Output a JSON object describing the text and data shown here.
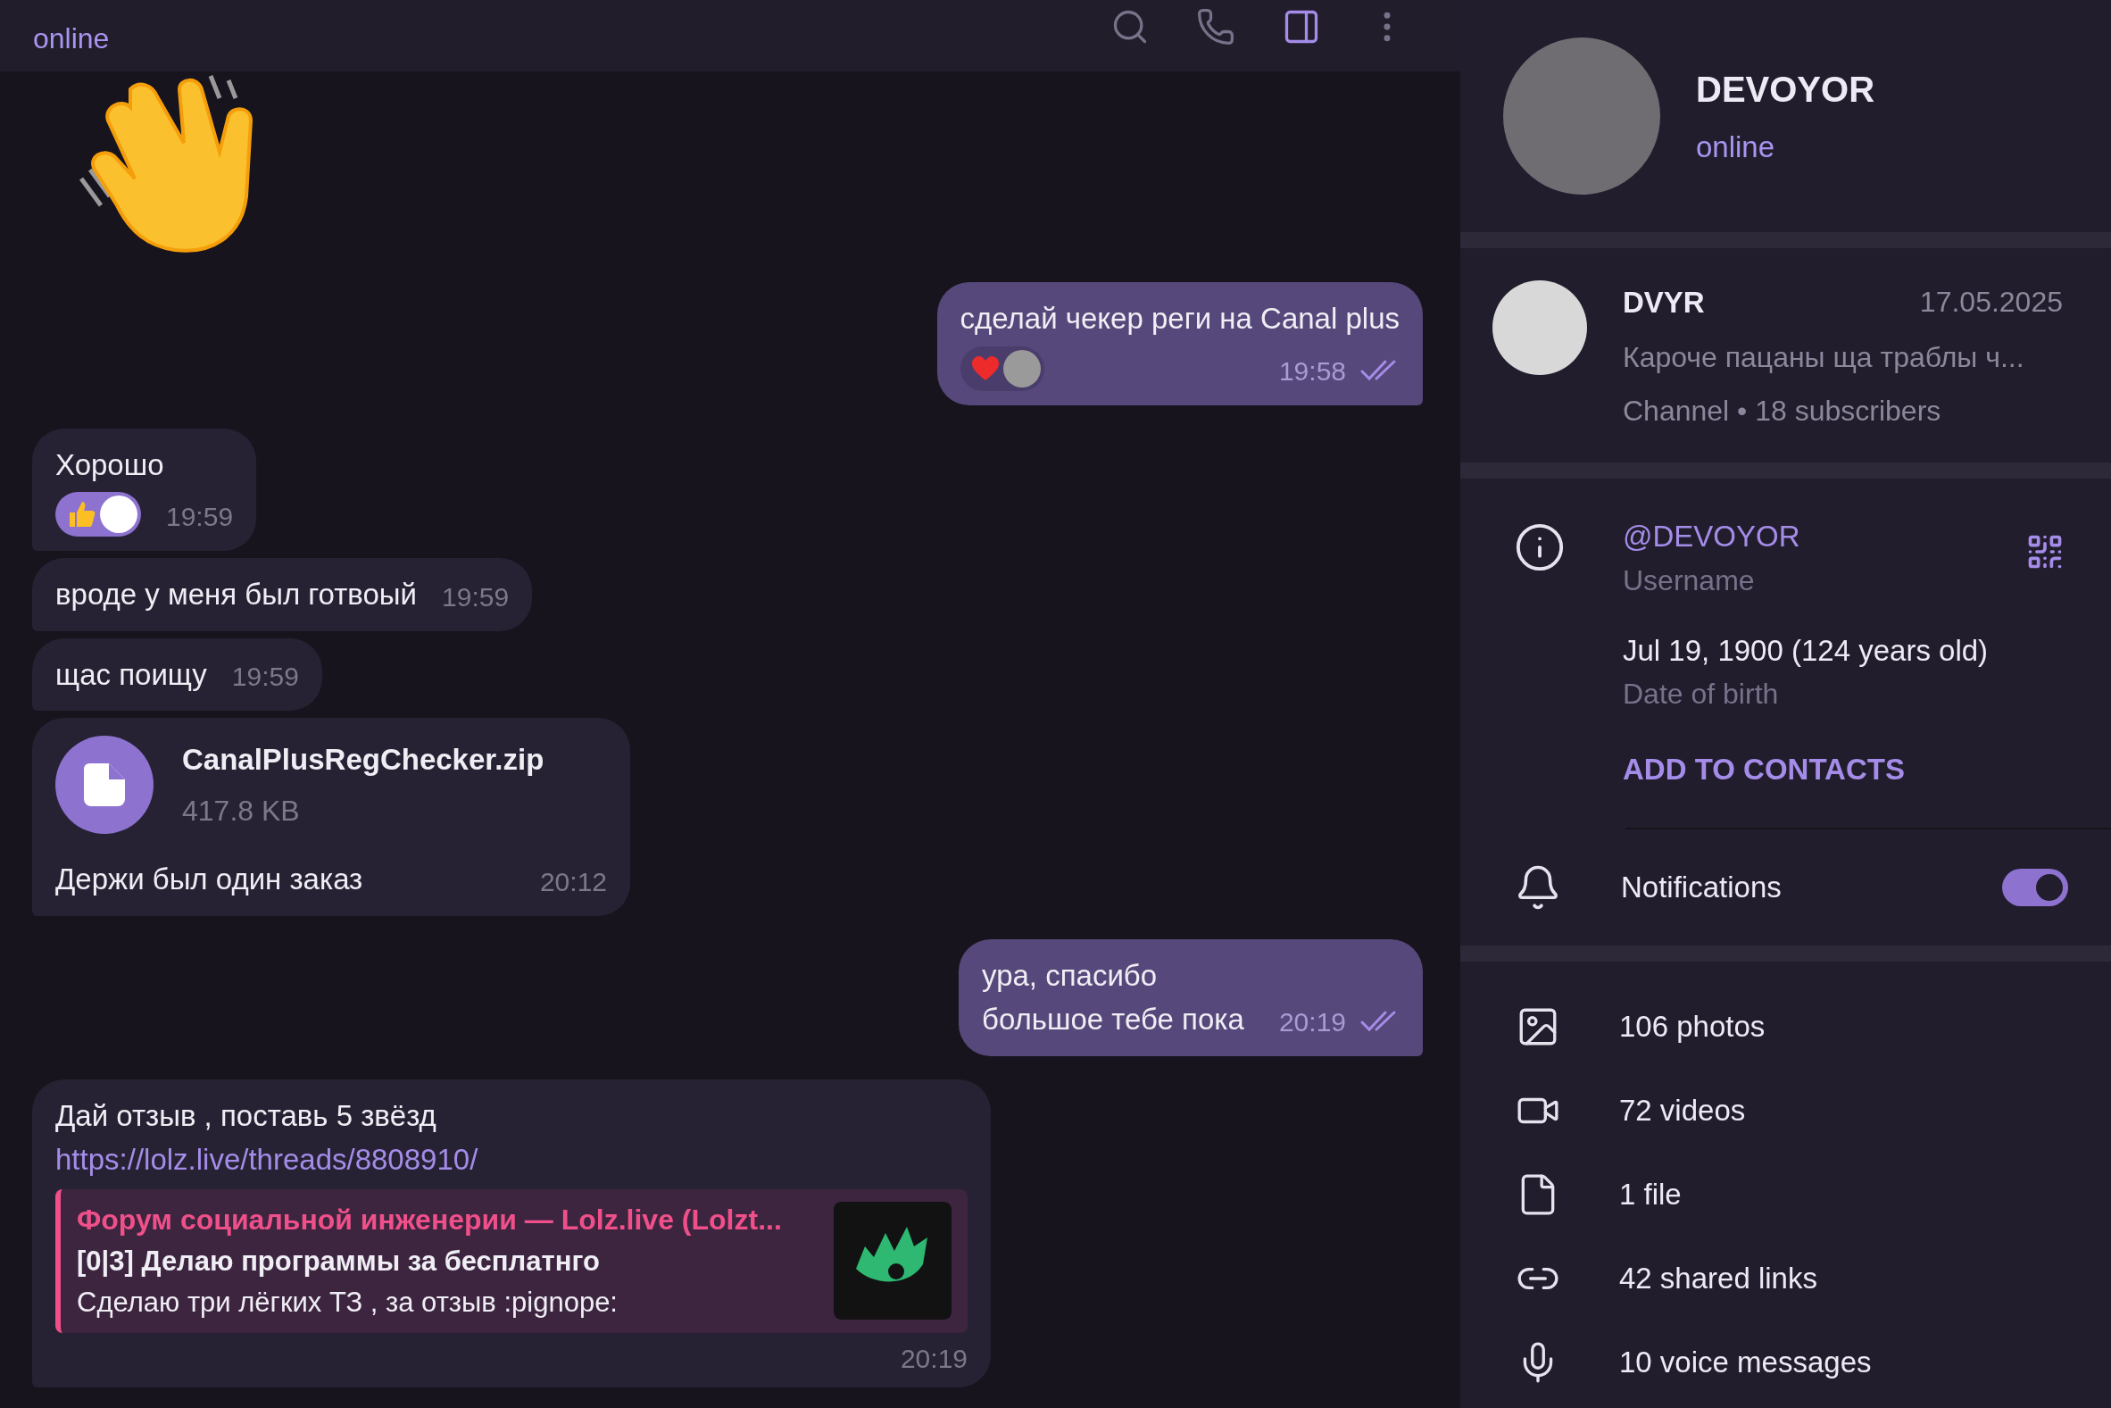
{
  "chat_header": {
    "status": "online",
    "icons": [
      {
        "kind": "search",
        "selected": false
      },
      {
        "kind": "call",
        "selected": false
      },
      {
        "kind": "sidebar",
        "selected": true
      },
      {
        "kind": "more",
        "selected": false
      }
    ]
  },
  "messages": [
    {
      "kind": "sticker",
      "outgoing": false
    },
    {
      "kind": "text",
      "outgoing": true,
      "text": "сделай чекер реги на Canal plus",
      "time": "19:58",
      "read": true,
      "reactions": [
        {
          "kind": "heart",
          "selected": false
        }
      ]
    },
    {
      "kind": "text",
      "outgoing": false,
      "text": "Хорошо",
      "time": "19:59",
      "reactions": [
        {
          "kind": "thumbs_up",
          "selected": true
        }
      ]
    },
    {
      "kind": "text",
      "outgoing": false,
      "text": "вроде у меня был готвоый",
      "time": "19:59"
    },
    {
      "kind": "text",
      "outgoing": false,
      "text": "щас поищу",
      "time": "19:59"
    },
    {
      "kind": "file",
      "outgoing": false,
      "file_name": "CanalPlusRegChecker.zip",
      "file_size": "417.8 KB",
      "text": "Держи был один заказ",
      "time": "20:12"
    },
    {
      "kind": "text",
      "outgoing": true,
      "text": "ура, спасибо большое тебе пока",
      "time": "20:19",
      "read": true
    },
    {
      "kind": "link",
      "outgoing": false,
      "text": "Дай отзыв , поставь 5 звёзд",
      "url": "https://lolz.live/threads/8808910/",
      "preview": {
        "site": "Форум социальной инженерии —  Lolz.live (Lolzt...",
        "title": "[0|3] Делаю программы за бесплатнго",
        "description": "Сделаю три лёгких ТЗ , за отзыв :pignope:"
      },
      "time": "20:19"
    }
  ],
  "profile": {
    "name": "DEVOYOR",
    "status": "online"
  },
  "channel": {
    "name": "DVYR",
    "date": "17.05.2025",
    "preview": "Кароче пацаны ща траблы ч...",
    "meta": "Channel • 18 subscribers"
  },
  "info": {
    "username": "@DEVOYOR",
    "username_label": "Username",
    "birth": "Jul 19, 1900 (124 years old)",
    "birth_label": "Date of birth",
    "add_contacts": "ADD TO CONTACTS",
    "notifications": {
      "label": "Notifications",
      "on": true
    }
  },
  "media": [
    {
      "kind": "photos",
      "label": "106 photos"
    },
    {
      "kind": "videos",
      "label": "72 videos"
    },
    {
      "kind": "files",
      "label": "1 file"
    },
    {
      "kind": "links",
      "label": "42 shared links"
    },
    {
      "kind": "voice",
      "label": "10 voice messages"
    }
  ]
}
